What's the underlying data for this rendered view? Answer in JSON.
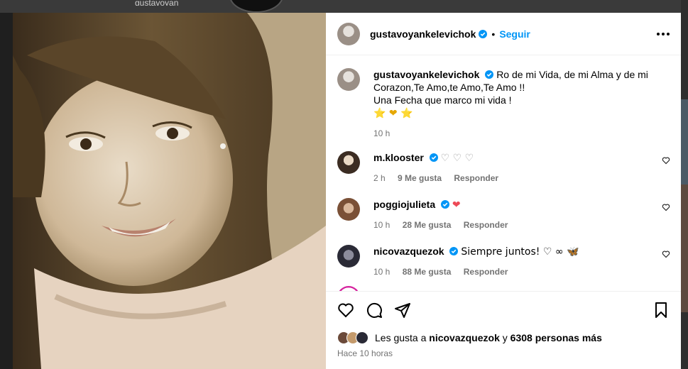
{
  "backdrop": {
    "username": "gustavoyan"
  },
  "post": {
    "author": "gustavoyankelevichok",
    "follow_label": "Seguir",
    "caption": "Ro de mi Vida, de mi Alma y de mi Corazon,Te Amo,te Amo,Te Amo !!",
    "caption_line2": "Una Fecha que marco mi vida !",
    "caption_emoji": "⭐ ❤ ⭐",
    "caption_time": "10 h"
  },
  "comments": [
    {
      "user": "m.klooster",
      "text": "♡ ♡ ♡",
      "time": "2 h",
      "likes": "9 Me gusta",
      "reply": "Responder"
    },
    {
      "user": "poggiojulieta",
      "text": "❤",
      "time": "10 h",
      "likes": "28 Me gusta",
      "reply": "Responder"
    },
    {
      "user": "nicovazquezok",
      "text": "Siempre juntos! ♡ ∞ 🦋",
      "time": "10 h",
      "likes": "88 Me gusta",
      "reply": "Responder"
    }
  ],
  "footer": {
    "likes_prefix": "Les gusta a",
    "likes_user": "nicovazquezok",
    "likes_mid": "y",
    "likes_count": "6308 personas más",
    "timestamp": "Hace 10 horas"
  },
  "icons": [
    "heart-icon",
    "comment-icon",
    "share-icon",
    "bookmark-icon",
    "more-icon",
    "verified-icon"
  ],
  "colors": {
    "accent": "#0095f6",
    "heart_red": "#ed4956",
    "star": "#f5c518",
    "muted": "#737373"
  }
}
